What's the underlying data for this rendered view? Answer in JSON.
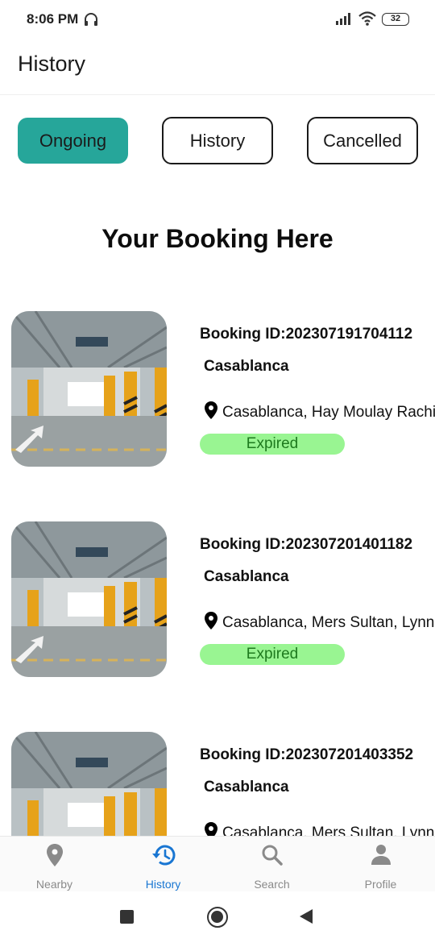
{
  "status_bar": {
    "time": "8:06 PM",
    "battery": "32",
    "icons": [
      "headset-icon",
      "signal-icon",
      "wifi-icon",
      "battery-icon"
    ]
  },
  "app_bar": {
    "title": "History"
  },
  "tabs": [
    {
      "label": "Ongoing",
      "active": true
    },
    {
      "label": "History",
      "active": false
    },
    {
      "label": "Cancelled",
      "active": false
    }
  ],
  "section_title": "Your Booking Here",
  "bookings": [
    {
      "booking_id": "Booking ID:202307191704112",
      "city": "Casablanca",
      "address": "Casablanca, Hay Moulay Rachi",
      "status": "Expired"
    },
    {
      "booking_id": "Booking ID:202307201401182",
      "city": "Casablanca",
      "address": "Casablanca, Mers Sultan, Lynn",
      "status": "Expired"
    },
    {
      "booking_id": "Booking ID:202307201403352",
      "city": "Casablanca",
      "address": "Casablanca, Mers Sultan, Lynn",
      "status": ""
    }
  ],
  "colors": {
    "accent": "#26a69a",
    "status_bg": "#99f592",
    "status_text": "#1e7a1e",
    "nav_active": "#1976d2",
    "nav_inactive": "#8a8a8a"
  },
  "bottom_nav": [
    {
      "label": "Nearby",
      "icon": "location-pin-icon",
      "active": false
    },
    {
      "label": "History",
      "icon": "history-icon",
      "active": true
    },
    {
      "label": "Search",
      "icon": "search-icon",
      "active": false
    },
    {
      "label": "Profile",
      "icon": "person-icon",
      "active": false
    }
  ]
}
